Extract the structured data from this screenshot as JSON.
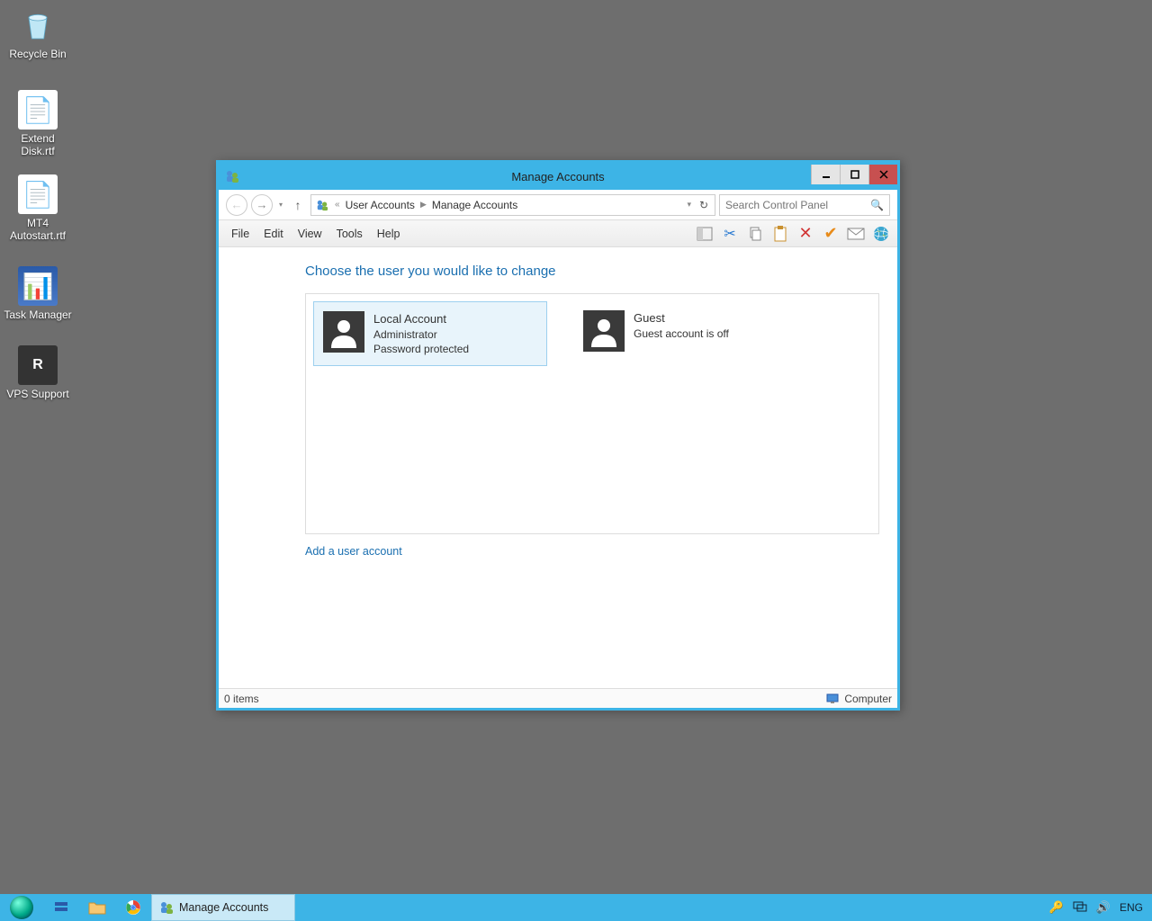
{
  "desktop_icons": [
    {
      "id": "recycle",
      "label": "Recycle Bin"
    },
    {
      "id": "extend",
      "label": "Extend Disk.rtf"
    },
    {
      "id": "mt4",
      "label": "MT4 Autostart.rtf"
    },
    {
      "id": "taskmgr",
      "label": "Task Manager"
    },
    {
      "id": "vps",
      "label": "VPS Support"
    }
  ],
  "window": {
    "title": "Manage Accounts",
    "breadcrumb": {
      "prefix": "«",
      "parts": [
        "User Accounts",
        "Manage Accounts"
      ]
    },
    "search_placeholder": "Search Control Panel",
    "menu": [
      "File",
      "Edit",
      "View",
      "Tools",
      "Help"
    ],
    "heading": "Choose the user you would like to change",
    "accounts": [
      {
        "name": "Local Account",
        "line2": "Administrator",
        "line3": "Password protected",
        "selected": true
      },
      {
        "name": "Guest",
        "line2": "Guest account is off",
        "line3": "",
        "selected": false
      }
    ],
    "add_link": "Add a user account",
    "status_left": "0 items",
    "status_right": "Computer"
  },
  "taskbar": {
    "task_label": "Manage Accounts",
    "lang": "ENG"
  }
}
